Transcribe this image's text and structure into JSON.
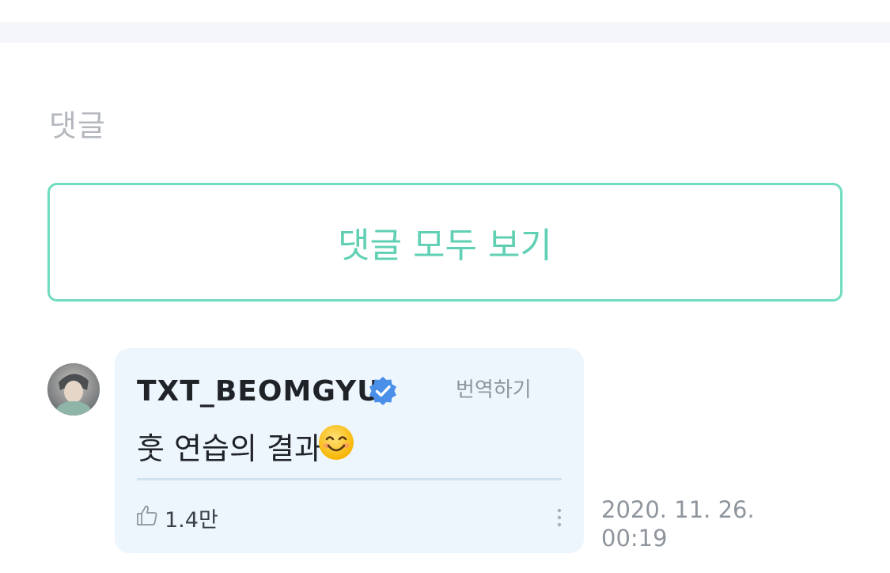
{
  "section": {
    "title": "댓글"
  },
  "view_all": {
    "label": "댓글 모두 보기"
  },
  "comment": {
    "author": "TXT_BEOMGYU",
    "verified_icon": "verified-badge-icon",
    "translate_label": "번역하기",
    "text": "훗 연습의 결과",
    "emoji_icon": "smiling-face-emoji",
    "like_icon": "thumbs-up-icon",
    "likes": "1.4만",
    "more_icon": "more-vertical-icon",
    "timestamp_line1": "2020. 11. 26.",
    "timestamp_line2": "00:19"
  },
  "colors": {
    "accent": "#5fd0b3",
    "accent_border": "#6fdcbf",
    "bubble_bg": "#eef6fd",
    "verified_blue": "#4a8fe8"
  }
}
